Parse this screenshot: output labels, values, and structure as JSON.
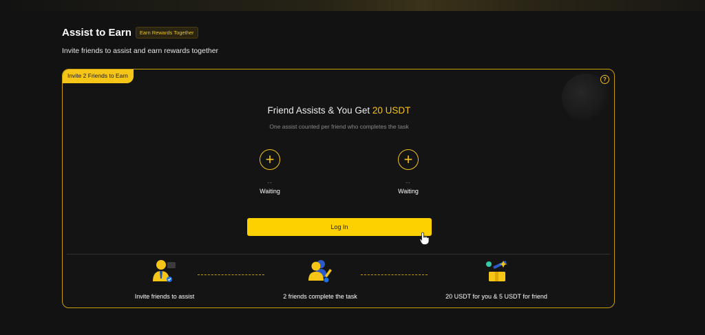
{
  "header": {
    "title": "Assist to Earn",
    "badge": "Earn Rewards Together",
    "subtitle": "Invite friends to assist and earn rewards together"
  },
  "card": {
    "tag": "Invite 2 Friends to Earn",
    "help_icon": "question-icon",
    "heading_prefix": "Friend Assists & You Get",
    "heading_amount": "20 USDT",
    "subheading": "One assist counted per friend who completes the task",
    "slots": [
      {
        "value": "--",
        "status": "Waiting"
      },
      {
        "value": "--",
        "status": "Waiting"
      }
    ],
    "login_label": "Log In"
  },
  "steps": [
    {
      "label": "Invite friends to assist",
      "icon": "invite-person-icon"
    },
    {
      "label": "2 friends complete the task",
      "icon": "friends-task-icon"
    },
    {
      "label": "20 USDT for you & 5 USDT for friend",
      "icon": "reward-gift-icon"
    }
  ],
  "colors": {
    "accent": "#f5c518",
    "button": "#fdd100",
    "background": "#121212"
  }
}
